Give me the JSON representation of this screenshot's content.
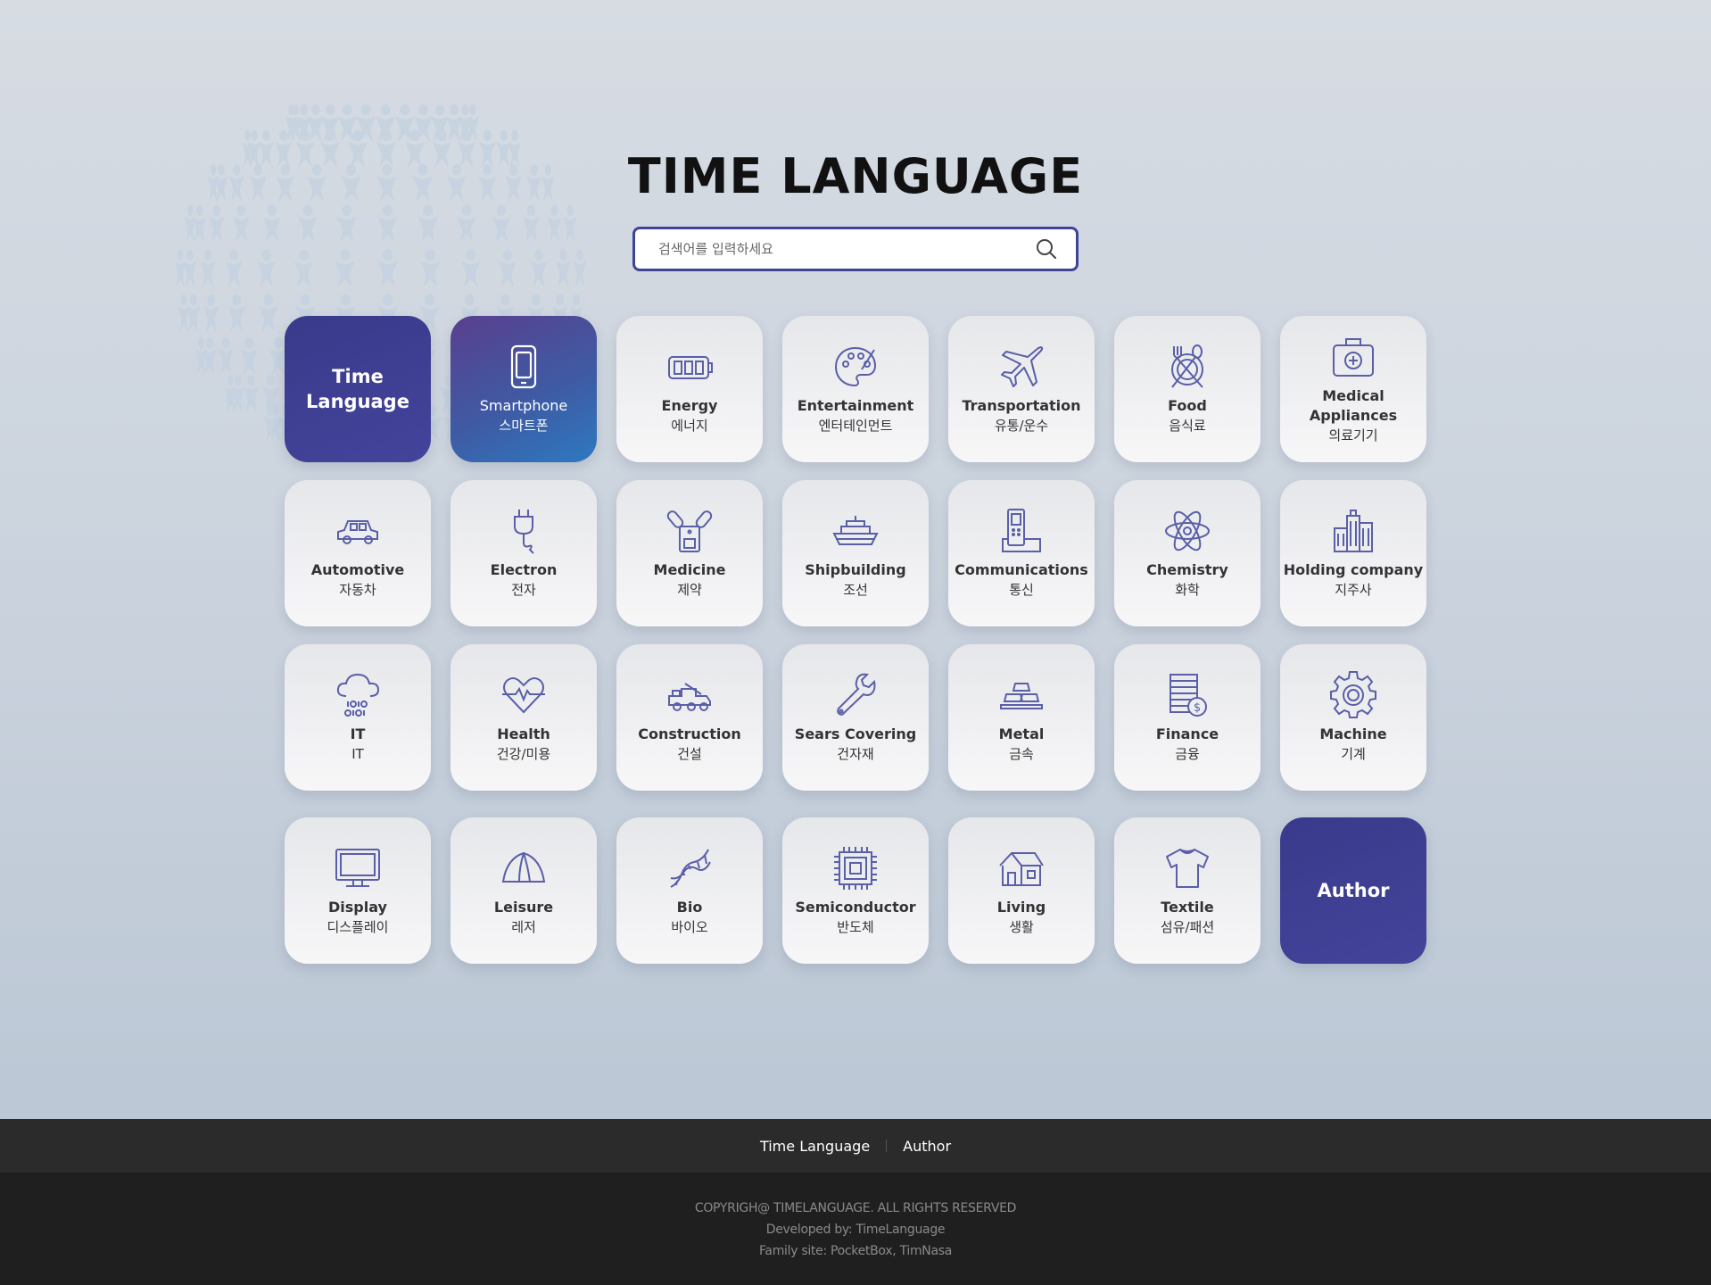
{
  "header": {
    "title": "TIME LANGUAGE"
  },
  "search": {
    "placeholder": "검색어를 입력하세요",
    "value": ""
  },
  "brand_card": {
    "line1": "Time",
    "line2": "Language"
  },
  "categories": [
    {
      "en": "Smartphone",
      "ko": "스마트폰",
      "icon": "smartphone-icon"
    },
    {
      "en": "Energy",
      "ko": "에너지",
      "icon": "battery-icon"
    },
    {
      "en": "Entertainment",
      "ko": "엔터테인먼트",
      "icon": "palette-icon"
    },
    {
      "en": "Transportation",
      "ko": "유통/운수",
      "icon": "airplane-icon"
    },
    {
      "en": "Food",
      "ko": "음식료",
      "icon": "cutlery-icon"
    },
    {
      "en": "Medical Appliances",
      "ko": "의료기기",
      "icon": "medical-kit-icon"
    },
    {
      "en": "Automotive",
      "ko": "자동차",
      "icon": "car-icon"
    },
    {
      "en": "Electron",
      "ko": "전자",
      "icon": "plug-icon"
    },
    {
      "en": "Medicine",
      "ko": "제약",
      "icon": "pill-icon"
    },
    {
      "en": "Shipbuilding",
      "ko": "조선",
      "icon": "ship-icon"
    },
    {
      "en": "Communications",
      "ko": "통신",
      "icon": "phone-icon"
    },
    {
      "en": "Chemistry",
      "ko": "화학",
      "icon": "atom-icon"
    },
    {
      "en": "Holding company",
      "ko": "지주사",
      "icon": "buildings-icon"
    },
    {
      "en": "IT",
      "ko": "IT",
      "icon": "cloud-data-icon"
    },
    {
      "en": "Health",
      "ko": "건강/미용",
      "icon": "heartbeat-icon"
    },
    {
      "en": "Construction",
      "ko": "건설",
      "icon": "truck-icon"
    },
    {
      "en": "Sears Covering",
      "ko": "건자재",
      "icon": "wrench-icon"
    },
    {
      "en": "Metal",
      "ko": "금속",
      "icon": "gold-bars-icon"
    },
    {
      "en": "Finance",
      "ko": "금융",
      "icon": "coins-icon"
    },
    {
      "en": "Machine",
      "ko": "기계",
      "icon": "gear-icon"
    },
    {
      "en": "Display",
      "ko": "디스플레이",
      "icon": "monitor-icon"
    },
    {
      "en": "Leisure",
      "ko": "레저",
      "icon": "tent-icon"
    },
    {
      "en": "Bio",
      "ko": "바이오",
      "icon": "dna-icon"
    },
    {
      "en": "Semiconductor",
      "ko": "반도체",
      "icon": "chip-icon"
    },
    {
      "en": "Living",
      "ko": "생활",
      "icon": "house-icon"
    },
    {
      "en": "Textile",
      "ko": "섬유/패션",
      "icon": "shirt-icon"
    }
  ],
  "author_card": {
    "label": "Author"
  },
  "footer_nav": {
    "link1": "Time Language",
    "link2": "Author"
  },
  "footer": {
    "copyright": "COPYRIGH@ TIMELANGUAGE. ALL RIGHTS RESERVED",
    "developed": "Developed by: TimeLanguage",
    "family": "Family site: PocketBox, TimNasa"
  },
  "colors": {
    "brand": "#3f4494",
    "icon": "#5a5fa8",
    "active_start": "#5a3f8e",
    "active_end": "#2d79c0"
  }
}
